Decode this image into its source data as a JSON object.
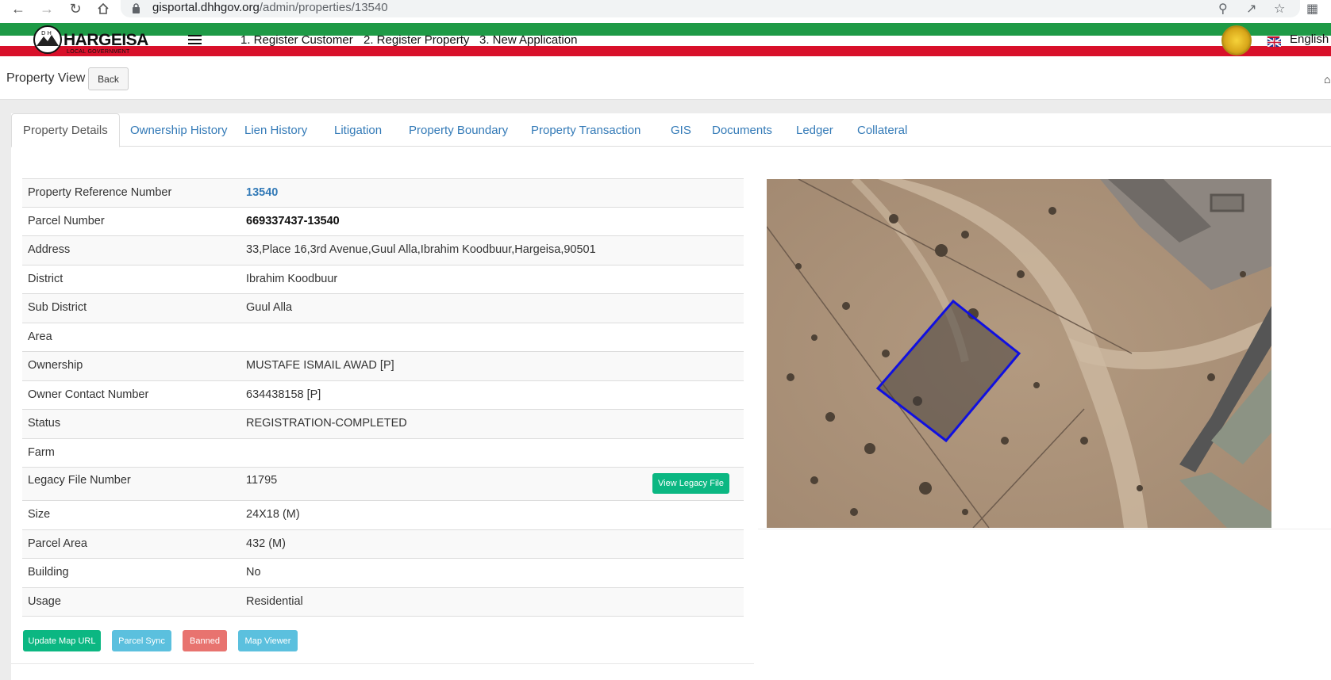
{
  "browser": {
    "url_host": "gisportal.dhhgov.org",
    "url_path": "/admin/properties/13540"
  },
  "header": {
    "logo_title": "HARGEISA",
    "logo_subtitle": "LOCAL GOVERNMENT",
    "nav": [
      "1. Register Customer",
      "2. Register Property",
      "3. New Application"
    ],
    "language": "English",
    "colors": {
      "green": "#1e9a46",
      "white": "#ffffff",
      "red": "#d8102a"
    }
  },
  "page": {
    "title": "Property View",
    "back_label": "Back"
  },
  "tabs": [
    "Property Details",
    "Ownership History",
    "Lien History",
    "Litigation",
    "Property Boundary",
    "Property Transaction",
    "GIS",
    "Documents",
    "Ledger",
    "Collateral"
  ],
  "details": [
    {
      "label": "Property Reference Number",
      "value": "13540"
    },
    {
      "label": "Parcel Number",
      "value": "669337437-13540"
    },
    {
      "label": "Address",
      "value": "33,Place 16,3rd Avenue,Guul Alla,Ibrahim Koodbuur,Hargeisa,90501"
    },
    {
      "label": "District",
      "value": "Ibrahim Koodbuur"
    },
    {
      "label": "Sub District",
      "value": "Guul Alla"
    },
    {
      "label": "Area",
      "value": ""
    },
    {
      "label": "Ownership",
      "value": "MUSTAFE ISMAIL AWAD [P]"
    },
    {
      "label": "Owner Contact Number",
      "value": "634438158 [P]"
    },
    {
      "label": "Status",
      "value": "REGISTRATION-COMPLETED"
    },
    {
      "label": "Farm",
      "value": ""
    },
    {
      "label": "Legacy File Number",
      "value": "11795"
    },
    {
      "label": "Size",
      "value": "24X18 (M)"
    },
    {
      "label": "Parcel Area",
      "value": "432 (M)"
    },
    {
      "label": "Building",
      "value": "No"
    },
    {
      "label": "Usage",
      "value": "Residential"
    }
  ],
  "legacy_button": "View Legacy File",
  "actions": {
    "update_map": "Update Map URL",
    "parcel_sync": "Parcel Sync",
    "banned": "Banned",
    "map_viewer": "Map Viewer"
  },
  "action_colors": {
    "update_map": "#0bb782",
    "parcel_sync": "#5bc0de",
    "banned": "#e8736f",
    "map_viewer": "#5bc0de"
  }
}
